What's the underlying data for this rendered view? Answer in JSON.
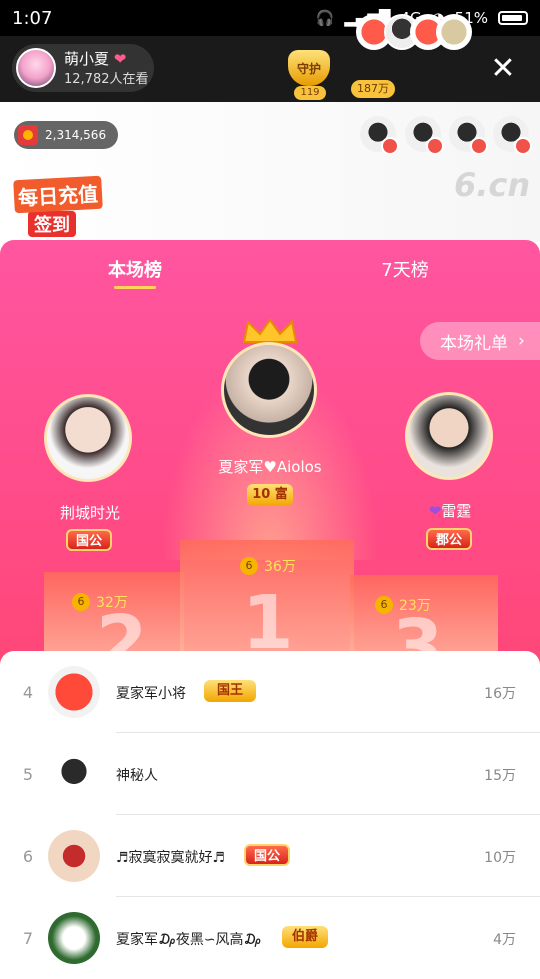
{
  "status": {
    "time": "1:07",
    "network": "4G",
    "battery": "51%"
  },
  "host": {
    "name": "萌小夏",
    "viewers": "12,782人在看"
  },
  "guard": {
    "label": "守护",
    "count": "119"
  },
  "viewer_count": "187万",
  "coins": {
    "value": "2,314,566"
  },
  "checkin": {
    "line1": "每日充值",
    "line2": "签到"
  },
  "watermark": "6.cn",
  "tabs": [
    {
      "label": "本场榜"
    },
    {
      "label": "7天榜"
    }
  ],
  "gift_list_button": "本场礼单",
  "top3": {
    "first": {
      "name": "夏家军♥Aiolos",
      "badge": "10 富",
      "value": "36万"
    },
    "second": {
      "name": "荆城时光",
      "badge": "国公",
      "value": "32万"
    },
    "third": {
      "name": "雷霆",
      "badge": "郡公",
      "value": "23万"
    }
  },
  "podium_numbers": [
    "2",
    "1",
    "3"
  ],
  "coin_icon": "6",
  "ranking": [
    {
      "rank": "4",
      "name": "夏家军小将",
      "badge": "国王",
      "value": "16万"
    },
    {
      "rank": "5",
      "name": "神秘人",
      "badge": "",
      "value": "15万"
    },
    {
      "rank": "6",
      "name": "♬寂寞寂寞就好♬",
      "badge": "国公",
      "value": "10万"
    },
    {
      "rank": "7",
      "name": "夏家军₯夜黑∽风高₯",
      "badge": "伯爵",
      "value": "4万"
    }
  ],
  "colors": {
    "panel_top": "#ff56a0",
    "panel_bottom": "#ff4458",
    "gold": "#ffd35a"
  }
}
